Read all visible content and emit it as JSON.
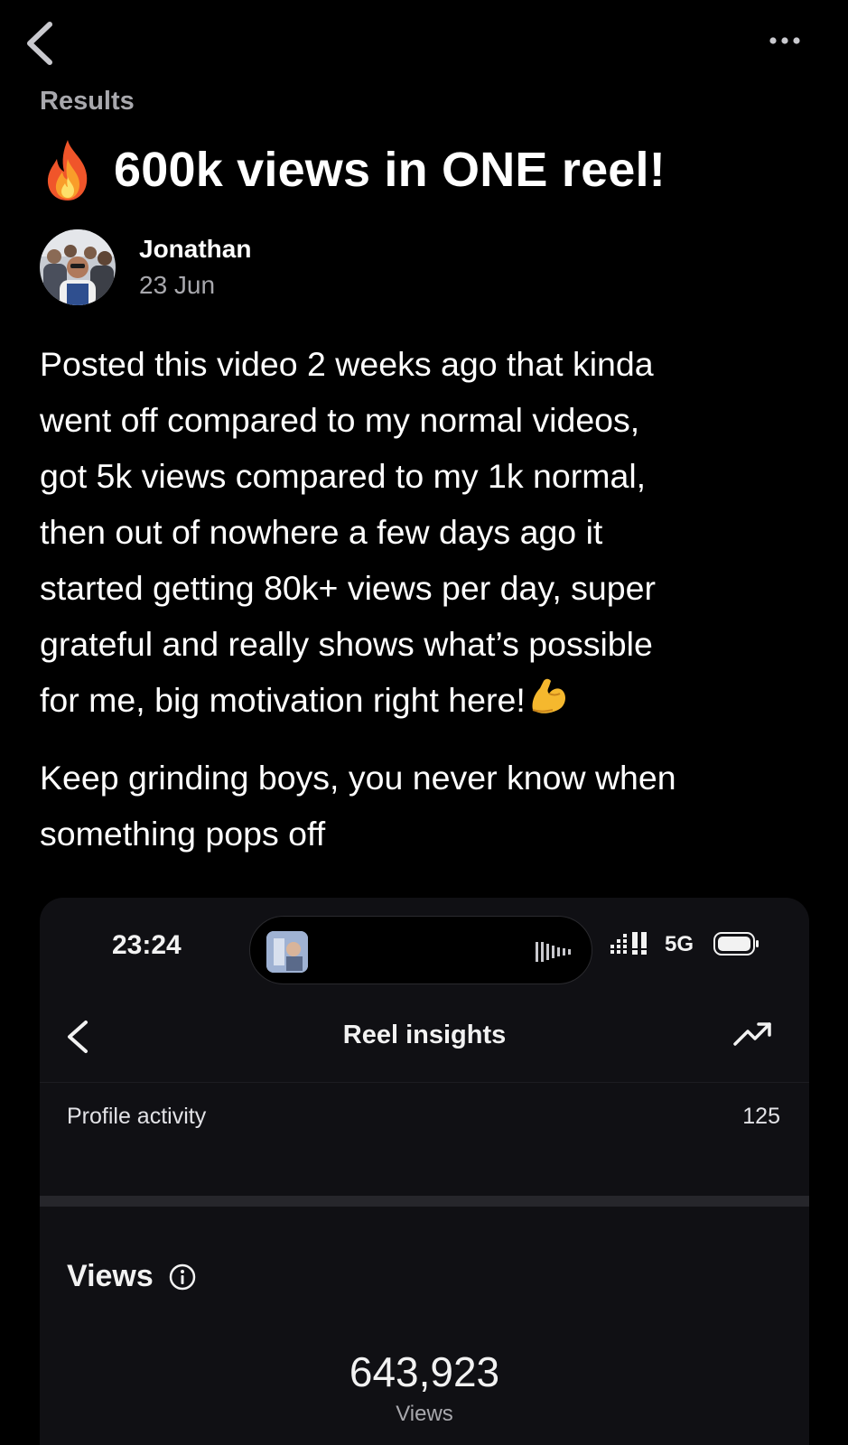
{
  "header": {
    "back_icon": "chevron-left-icon",
    "more_icon": "more-horizontal-icon",
    "breadcrumb": "Results"
  },
  "post": {
    "title_icon": "fire-icon",
    "title": "600k views in ONE reel!",
    "author": {
      "name": "Jonathan",
      "date": "23 Jun",
      "avatar_icon": "avatar"
    },
    "body": {
      "line1": "Posted this video 2 weeks ago that kinda",
      "line2": "went off compared to my normal videos,",
      "line3": "got 5k views compared to my 1k normal,",
      "line4": "then out of nowhere a few days ago it",
      "line5": "started getting 80k+ views per day, super",
      "line6": "grateful and really shows what’s possible",
      "line7": "for me, big motivation right here!",
      "line7_icon": "flexed-biceps-icon",
      "line8": "Keep grinding boys, you never know when",
      "line9": "something pops off"
    }
  },
  "embedded_screenshot": {
    "status_time": "23:24",
    "network": "5G",
    "nav_title": "Reel insights",
    "nav_back_icon": "chevron-left-icon",
    "nav_right_icon": "trending-up-icon",
    "profile_activity_label": "Profile activity",
    "profile_activity_value": "125",
    "views_heading": "Views",
    "views_value": "643,923",
    "views_caption": "Views"
  },
  "colors": {
    "background": "#000000",
    "text_primary": "#ffffff",
    "text_secondary": "#a8a8ad",
    "card_background": "#101014",
    "accent_emoji": "#f5b82e"
  }
}
